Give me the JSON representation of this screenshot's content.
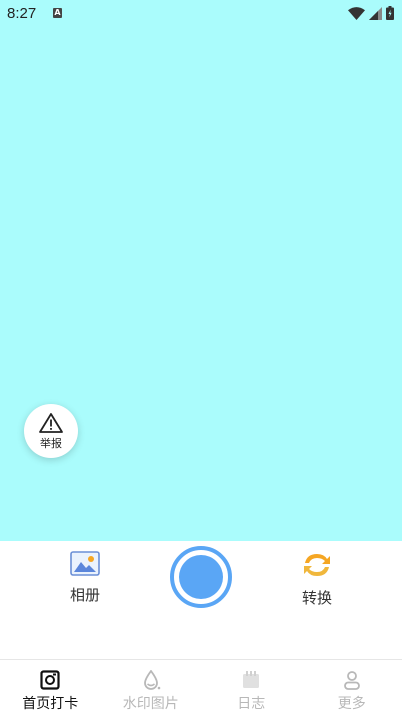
{
  "status_bar": {
    "time": "8:27",
    "notification_glyph": "A"
  },
  "report": {
    "label": "举报",
    "icon": "warning-triangle-icon"
  },
  "controls": {
    "album": {
      "label": "相册",
      "icon": "image-icon"
    },
    "convert": {
      "label": "转换",
      "icon": "swap-arrows-icon"
    },
    "shutter_color": "#5aa6f5"
  },
  "tabbar": {
    "tabs": [
      {
        "label": "首页打卡",
        "icon": "camera-frame-icon",
        "active": true
      },
      {
        "label": "水印图片",
        "icon": "water-drop-icon",
        "active": false
      },
      {
        "label": "日志",
        "icon": "calendar-icon",
        "active": false
      },
      {
        "label": "更多",
        "icon": "person-icon",
        "active": false
      }
    ]
  },
  "colors": {
    "camera_bg": "#aafcfc",
    "accent": "#5aa6f5",
    "convert_orange": "#f5a623"
  }
}
